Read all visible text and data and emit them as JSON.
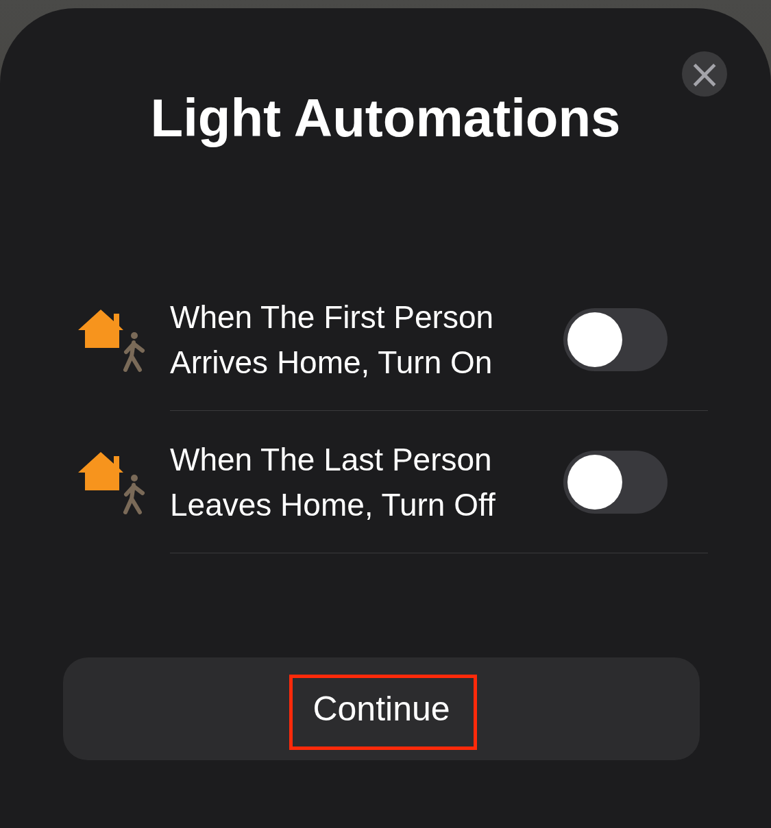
{
  "sheet": {
    "title": "Light Automations",
    "close_button": "×"
  },
  "automations": [
    {
      "label": "When The First Person Arrives Home, Turn On",
      "on": false
    },
    {
      "label": "When The Last Person Leaves Home, Turn Off",
      "on": false
    }
  ],
  "continue_button": {
    "label": "Continue",
    "highlighted": true
  }
}
